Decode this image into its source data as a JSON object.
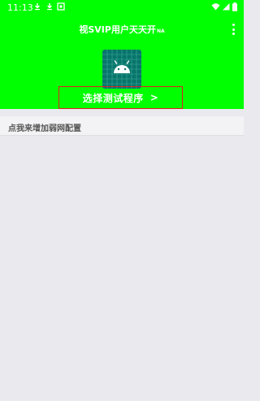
{
  "status_bar": {
    "time": "11:13"
  },
  "header": {
    "title": "视SVIP用户天天开",
    "title_suffix": "NA",
    "select_button_label": "选择测试程序",
    "select_button_chevron": ">"
  },
  "list": {
    "row_label": "点我来增加弱网配置"
  },
  "colors": {
    "header_bg": "#00ff00",
    "highlight_border": "#e02020",
    "app_icon_bg": "#08756b",
    "page_bg": "#e9e9ee"
  },
  "icons": {
    "status_left": [
      "download-icon",
      "download-icon",
      "app-notification-icon"
    ],
    "status_right": [
      "wifi-icon",
      "signal-icon",
      "battery-icon"
    ],
    "app": "android-robot-icon",
    "menu": "more-vert-icon"
  }
}
